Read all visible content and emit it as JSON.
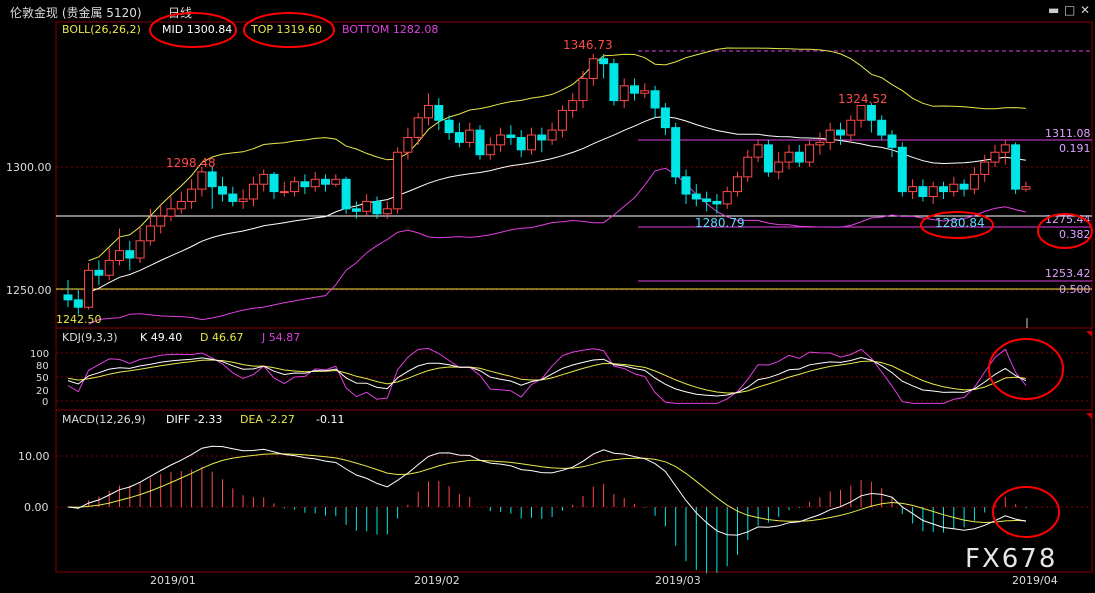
{
  "window": {
    "title": "伦敦金现 (贵金属 5120)",
    "period": "日线",
    "controls": [
      "minimize-icon",
      "restore-icon",
      "close-icon"
    ]
  },
  "colors": {
    "up": "#ff4a4a",
    "down": "#00e5e5",
    "mid": "#ffffff",
    "boll_upper": "#e8e84a",
    "bottom": "#e040e0",
    "grid": "#880000",
    "k": "#ffffff",
    "d": "#e8e84a",
    "j": "#e040e0",
    "fib": "#e040e0",
    "circle": "#ff0000"
  },
  "price_panel": {
    "indicator_name": "BOLL(26,26,2)",
    "mid": "MID 1300.84",
    "top": "TOP 1319.60",
    "bottom": "BOTTOM 1282.08",
    "y_ticks": [
      "1300.00",
      "1250.00"
    ],
    "annotations": {
      "high1": "1298.48",
      "high2": "1346.73",
      "high3": "1324.52",
      "low1": "1280.79",
      "low2": "1280.84",
      "start": "1242.50"
    },
    "fib_levels": [
      {
        "price": "1311.08",
        "ratio": "0.191"
      },
      {
        "price": "1275.44",
        "ratio": "0.382"
      },
      {
        "price": "1253.42",
        "ratio": "0.500"
      }
    ]
  },
  "kdj_panel": {
    "name": "KDJ(9,3,3)",
    "k": "K 49.40",
    "d": "D 46.67",
    "j": "J 54.87",
    "y_ticks": [
      "100",
      "80",
      "50",
      "20",
      "0"
    ]
  },
  "macd_panel": {
    "name": "MACD(12,26,9)",
    "diff": "DIFF -2.33",
    "dea": "DEA -2.27",
    "macd": "-0.11",
    "y_ticks": [
      "10.00",
      "0.00"
    ]
  },
  "x_axis": [
    "2019/01",
    "2019/02",
    "2019/03",
    "2019/04"
  ],
  "watermark": "FX678",
  "chart_data": {
    "type": "candlestick",
    "title": "伦敦金现 (贵金属 5120) 日线",
    "ylim": [
      1235,
      1355
    ],
    "candles": [
      [
        1248,
        1246,
        1254,
        1243
      ],
      [
        1246,
        1243,
        1250,
        1240
      ],
      [
        1243,
        1258,
        1261,
        1242
      ],
      [
        1258,
        1256,
        1262,
        1252
      ],
      [
        1256,
        1262,
        1267,
        1254
      ],
      [
        1262,
        1266,
        1275,
        1260
      ],
      [
        1266,
        1263,
        1270,
        1258
      ],
      [
        1263,
        1270,
        1276,
        1261
      ],
      [
        1270,
        1276,
        1283,
        1268
      ],
      [
        1276,
        1280,
        1285,
        1273
      ],
      [
        1280,
        1283,
        1288,
        1278
      ],
      [
        1283,
        1286,
        1290,
        1281
      ],
      [
        1286,
        1291,
        1295,
        1283
      ],
      [
        1291,
        1298,
        1300,
        1288
      ],
      [
        1298,
        1292,
        1300,
        1283
      ],
      [
        1292,
        1289,
        1296,
        1286
      ],
      [
        1289,
        1286,
        1292,
        1284
      ],
      [
        1286,
        1287,
        1291,
        1283
      ],
      [
        1287,
        1293,
        1296,
        1284
      ],
      [
        1293,
        1297,
        1299,
        1290
      ],
      [
        1297,
        1290,
        1298,
        1287
      ],
      [
        1290,
        1290,
        1294,
        1288
      ],
      [
        1290,
        1294,
        1296,
        1288
      ],
      [
        1294,
        1292,
        1297,
        1289
      ],
      [
        1292,
        1295,
        1298,
        1290
      ],
      [
        1295,
        1293,
        1297,
        1290
      ],
      [
        1293,
        1295,
        1297,
        1292
      ],
      [
        1295,
        1283,
        1296,
        1281
      ],
      [
        1283,
        1282,
        1286,
        1279
      ],
      [
        1282,
        1286,
        1289,
        1280
      ],
      [
        1286,
        1281,
        1288,
        1279
      ],
      [
        1281,
        1283,
        1286,
        1279
      ],
      [
        1283,
        1306,
        1308,
        1281
      ],
      [
        1306,
        1312,
        1316,
        1303
      ],
      [
        1312,
        1320,
        1322,
        1309
      ],
      [
        1320,
        1325,
        1330,
        1317
      ],
      [
        1325,
        1319,
        1328,
        1315
      ],
      [
        1319,
        1314,
        1321,
        1311
      ],
      [
        1314,
        1310,
        1318,
        1308
      ],
      [
        1310,
        1315,
        1318,
        1308
      ],
      [
        1315,
        1305,
        1317,
        1303
      ],
      [
        1305,
        1309,
        1312,
        1303
      ],
      [
        1309,
        1313,
        1316,
        1306
      ],
      [
        1313,
        1312,
        1317,
        1309
      ],
      [
        1312,
        1307,
        1315,
        1304
      ],
      [
        1307,
        1313,
        1316,
        1305
      ],
      [
        1313,
        1311,
        1316,
        1306
      ],
      [
        1311,
        1315,
        1318,
        1309
      ],
      [
        1315,
        1323,
        1325,
        1312
      ],
      [
        1323,
        1327,
        1330,
        1320
      ],
      [
        1327,
        1336,
        1339,
        1324
      ],
      [
        1336,
        1344,
        1346,
        1333
      ],
      [
        1344,
        1342,
        1346,
        1336
      ],
      [
        1342,
        1327,
        1344,
        1325
      ],
      [
        1327,
        1333,
        1336,
        1324
      ],
      [
        1333,
        1330,
        1336,
        1327
      ],
      [
        1330,
        1331,
        1334,
        1328
      ],
      [
        1331,
        1324,
        1333,
        1320
      ],
      [
        1324,
        1316,
        1326,
        1313
      ],
      [
        1316,
        1296,
        1318,
        1293
      ],
      [
        1296,
        1289,
        1299,
        1285
      ],
      [
        1289,
        1287,
        1293,
        1284
      ],
      [
        1287,
        1286,
        1290,
        1282
      ],
      [
        1286,
        1285,
        1289,
        1281
      ],
      [
        1285,
        1290,
        1292,
        1283
      ],
      [
        1290,
        1296,
        1298,
        1288
      ],
      [
        1296,
        1304,
        1307,
        1294
      ],
      [
        1304,
        1309,
        1311,
        1302
      ],
      [
        1309,
        1298,
        1311,
        1296
      ],
      [
        1298,
        1302,
        1306,
        1295
      ],
      [
        1302,
        1306,
        1309,
        1299
      ],
      [
        1306,
        1302,
        1309,
        1300
      ],
      [
        1302,
        1309,
        1311,
        1300
      ],
      [
        1309,
        1310,
        1314,
        1305
      ],
      [
        1310,
        1315,
        1318,
        1307
      ],
      [
        1315,
        1313,
        1318,
        1309
      ],
      [
        1313,
        1319,
        1321,
        1310
      ],
      [
        1319,
        1325,
        1324,
        1316
      ],
      [
        1325,
        1319,
        1326,
        1314
      ],
      [
        1319,
        1313,
        1321,
        1311
      ],
      [
        1313,
        1308,
        1315,
        1304
      ],
      [
        1308,
        1290,
        1310,
        1288
      ],
      [
        1290,
        1292,
        1295,
        1287
      ],
      [
        1292,
        1288,
        1295,
        1286
      ],
      [
        1288,
        1292,
        1294,
        1285
      ],
      [
        1292,
        1290,
        1294,
        1287
      ],
      [
        1290,
        1293,
        1296,
        1288
      ],
      [
        1293,
        1291,
        1295,
        1288
      ],
      [
        1291,
        1297,
        1300,
        1289
      ],
      [
        1297,
        1302,
        1305,
        1294
      ],
      [
        1302,
        1306,
        1309,
        1300
      ],
      [
        1306,
        1309,
        1311,
        1301
      ],
      [
        1309,
        1291,
        1310,
        1289
      ],
      [
        1291,
        1292,
        1294,
        1290
      ]
    ]
  }
}
